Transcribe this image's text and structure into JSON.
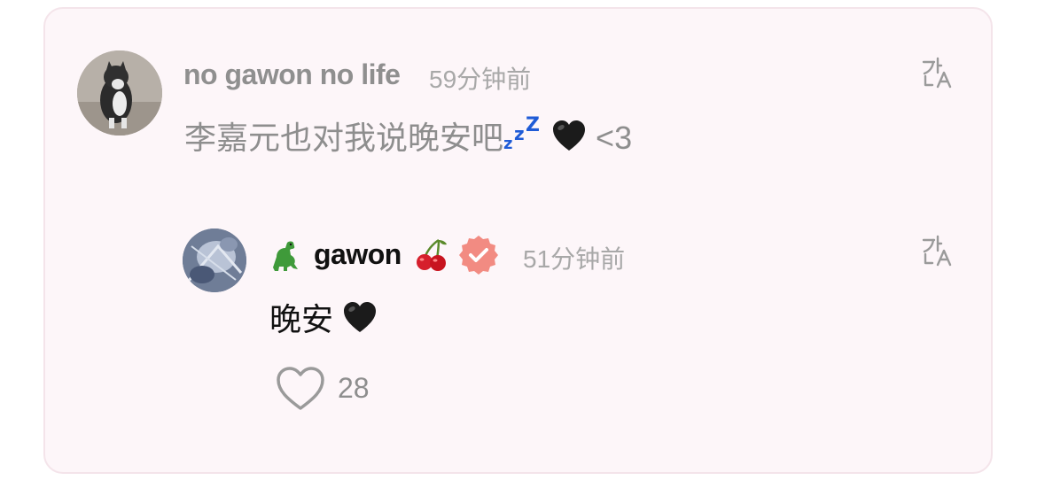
{
  "comment": {
    "username": "no gawon no life",
    "time": "59分钟前",
    "text": "李嘉元也对我说晚安吧",
    "text_suffix": "<3"
  },
  "reply": {
    "username": "gawon",
    "time": "51分钟前",
    "text": "晚安",
    "like_count": "28"
  },
  "icons": {
    "translate": "translate-icon",
    "like": "heart-outline-icon",
    "verified": "verified-badge-icon",
    "dino": "dinosaur-emoji",
    "cherry": "cherry-emoji",
    "black_heart": "black-heart-emoji",
    "zzz": "zzz-emoji"
  },
  "colors": {
    "card_bg": "#fdf6f9",
    "card_border": "#f4e4ea",
    "verified_badge": "#f28b82",
    "zzz_blue": "#1f5bd6"
  }
}
